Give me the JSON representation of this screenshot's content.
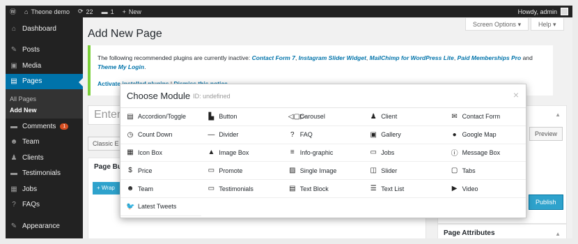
{
  "adminbar": {
    "wp_icon": "wordpress-icon",
    "site_name": "Theone demo",
    "updates_count": "22",
    "comments_count": "1",
    "new_label": "New",
    "howdy": "Howdy, admin"
  },
  "sidebar": {
    "items": [
      {
        "label": "Dashboard",
        "icon": "dashboard-icon",
        "glyph": "⌂"
      },
      {
        "label": "Posts",
        "icon": "pin-icon",
        "glyph": "✎"
      },
      {
        "label": "Media",
        "icon": "media-icon",
        "glyph": "▣"
      },
      {
        "label": "Pages",
        "icon": "pages-icon",
        "glyph": "▤"
      },
      {
        "label": "Comments",
        "icon": "comments-icon",
        "glyph": "▬",
        "badge": "1"
      },
      {
        "label": "Team",
        "icon": "team-icon",
        "glyph": "☻"
      },
      {
        "label": "Clients",
        "icon": "clients-icon",
        "glyph": "♟"
      },
      {
        "label": "Testimonials",
        "icon": "testimonials-icon",
        "glyph": "▬"
      },
      {
        "label": "Jobs",
        "icon": "jobs-icon",
        "glyph": "▦"
      },
      {
        "label": "FAQs",
        "icon": "faq-icon",
        "glyph": "?"
      },
      {
        "label": "Appearance",
        "icon": "appearance-icon",
        "glyph": "✎"
      }
    ],
    "submenu": [
      "All Pages",
      "Add New"
    ]
  },
  "header": {
    "screen_options": "Screen Options",
    "help": "Help",
    "title": "Add New Page"
  },
  "notice": {
    "text": "The following recommended plugins are currently inactive:",
    "plugins": [
      "Contact Form 7",
      "Instagram Slider Widget",
      "MailChimp for WordPress Lite",
      "Paid Memberships Pro",
      "Theme My Login"
    ],
    "and": "and",
    "activate": "Activate installed plugins",
    "dismiss": "Dismiss this notice"
  },
  "editor": {
    "title_placeholder": "Enter",
    "classic_button": "Classic E",
    "page_builder": "Page Bu",
    "wrap_button": "+ Wrap"
  },
  "side": {
    "preview": "Preview",
    "publish": "Publish",
    "page_attributes": "Page Attributes"
  },
  "modal": {
    "title": "Choose Module",
    "id_label": "ID: undefined",
    "close": "×",
    "modules": [
      {
        "label": "Accordion/Toggle",
        "icon": "accordion-icon",
        "glyph": "▤"
      },
      {
        "label": "Button",
        "icon": "button-icon",
        "glyph": "▙"
      },
      {
        "label": "Carousel",
        "icon": "carousel-icon",
        "glyph": "◁▢▷"
      },
      {
        "label": "Client",
        "icon": "client-icon",
        "glyph": "♟"
      },
      {
        "label": "Contact Form",
        "icon": "envelope-icon",
        "glyph": "✉"
      },
      {
        "label": "Count Down",
        "icon": "stopwatch-icon",
        "glyph": "◷"
      },
      {
        "label": "Divider",
        "icon": "divider-icon",
        "glyph": "—"
      },
      {
        "label": "FAQ",
        "icon": "question-icon",
        "glyph": "?"
      },
      {
        "label": "Gallery",
        "icon": "gallery-icon",
        "glyph": "▣"
      },
      {
        "label": "Google Map",
        "icon": "map-pin-icon",
        "glyph": "●"
      },
      {
        "label": "Icon Box",
        "icon": "icon-box-icon",
        "glyph": "▦"
      },
      {
        "label": "Image Box",
        "icon": "image-box-icon",
        "glyph": "▲"
      },
      {
        "label": "Info-graphic",
        "icon": "infographic-icon",
        "glyph": "≡"
      },
      {
        "label": "Jobs",
        "icon": "jobs-icon",
        "glyph": "▭"
      },
      {
        "label": "Message Box",
        "icon": "info-icon",
        "glyph": "ⓘ"
      },
      {
        "label": "Price",
        "icon": "dollar-icon",
        "glyph": "$"
      },
      {
        "label": "Promote",
        "icon": "promote-icon",
        "glyph": "▭"
      },
      {
        "label": "Single Image",
        "icon": "image-icon",
        "glyph": "▨"
      },
      {
        "label": "Slider",
        "icon": "slider-icon",
        "glyph": "◫"
      },
      {
        "label": "Tabs",
        "icon": "tabs-icon",
        "glyph": "▢"
      },
      {
        "label": "Team",
        "icon": "team-icon",
        "glyph": "☻"
      },
      {
        "label": "Testimonials",
        "icon": "testimonials-icon",
        "glyph": "▭"
      },
      {
        "label": "Text Block",
        "icon": "text-block-icon",
        "glyph": "▤"
      },
      {
        "label": "Text List",
        "icon": "list-icon",
        "glyph": "☰"
      },
      {
        "label": "Video",
        "icon": "video-icon",
        "glyph": "▶"
      },
      {
        "label": "Latest Tweets",
        "icon": "twitter-icon",
        "glyph": "🐦"
      }
    ]
  }
}
